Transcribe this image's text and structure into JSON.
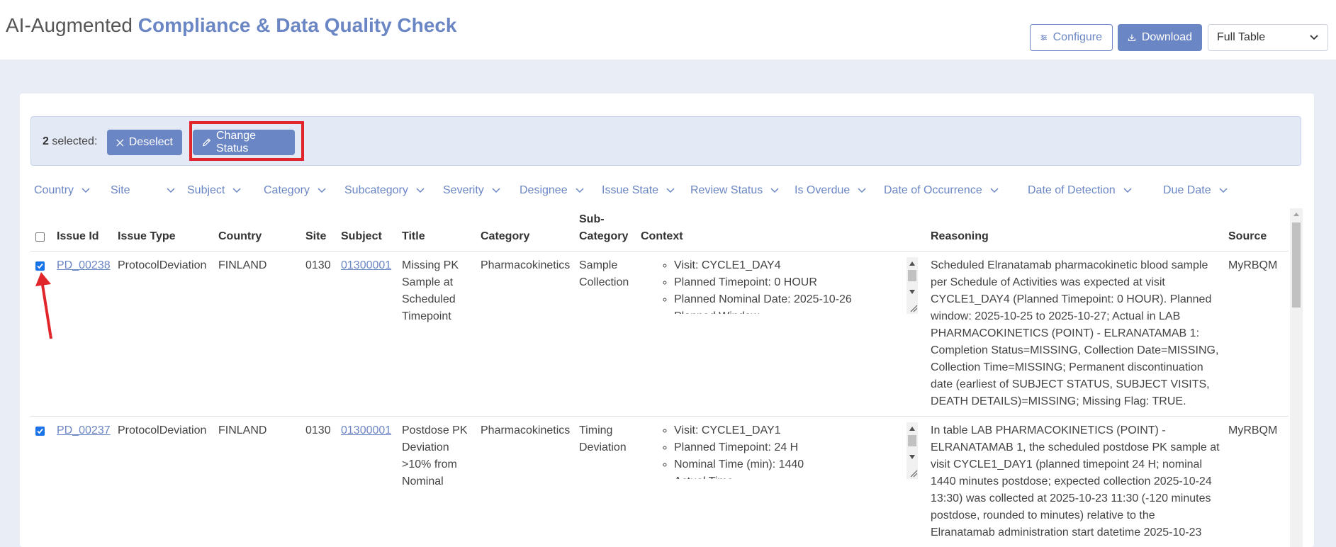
{
  "app": {
    "title_light": "AI-Augmented",
    "title_bold": "Compliance & Data Quality Check"
  },
  "toolbar": {
    "configure_label": "Configure",
    "download_label": "Download",
    "view_select_value": "Full Table"
  },
  "selection": {
    "count": "2",
    "count_suffix": "selected:",
    "deselect_label": "Deselect",
    "change_status_label": "Change Status"
  },
  "filters": [
    "Country",
    "Site",
    "Subject",
    "Category",
    "Subcategory",
    "Severity",
    "Designee",
    "Issue State",
    "Review Status",
    "Is Overdue",
    "Date of Occurrence",
    "Date of Detection",
    "Due Date"
  ],
  "table": {
    "headers": {
      "issue_id": "Issue Id",
      "issue_type": "Issue Type",
      "country": "Country",
      "site": "Site",
      "subject": "Subject",
      "title": "Title",
      "category": "Category",
      "subcategory_line1": "Sub-",
      "subcategory_line2": "Category",
      "context": "Context",
      "reasoning": "Reasoning",
      "source": "Source"
    },
    "rows": [
      {
        "issue_id": "PD_00238",
        "issue_type": "ProtocolDeviation",
        "country": "FINLAND",
        "site": "0130",
        "subject": "01300001",
        "title": "Missing PK Sample at Scheduled Timepoint",
        "category": "Pharmacokinetics",
        "subcategory": "Sample Collection",
        "context": [
          "Visit: CYCLE1_DAY4",
          "Planned Timepoint: 0 HOUR",
          "Planned Nominal Date: 2025-10-26",
          "Planned Window"
        ],
        "reasoning": "Scheduled Elranatamab pharmacokinetic blood sample per Schedule of Activities was expected at visit CYCLE1_DAY4 (Planned Timepoint: 0 HOUR). Planned window: 2025-10-25 to 2025-10-27; Actual in LAB PHARMACOKINETICS (POINT) - ELRANATAMAB 1: Completion Status=MISSING, Collection Date=MISSING, Collection Time=MISSING; Permanent discontinuation date (earliest of SUBJECT STATUS, SUBJECT VISITS, DEATH DETAILS)=MISSING; Missing Flag: TRUE.",
        "source": "MyRBQM",
        "selected": true
      },
      {
        "issue_id": "PD_00237",
        "issue_type": "ProtocolDeviation",
        "country": "FINLAND",
        "site": "0130",
        "subject": "01300001",
        "title": "Postdose PK Deviation >10% from Nominal",
        "category": "Pharmacokinetics",
        "subcategory": "Timing Deviation",
        "context": [
          "Visit: CYCLE1_DAY1",
          "Planned Timepoint: 24 H",
          "Nominal Time (min): 1440",
          "Actual Time"
        ],
        "reasoning": "In table LAB PHARMACOKINETICS (POINT) - ELRANATAMAB 1, the scheduled postdose PK sample at visit CYCLE1_DAY1 (planned timepoint 24 H; nominal 1440 minutes postdose; expected collection 2025-10-24 13:30) was collected at 2025-10-23 11:30 (-120 minutes postdose, rounded to minutes) relative to the Elranatamab administration start datetime 2025-10-23",
        "source": "MyRBQM",
        "selected": true
      }
    ]
  },
  "colors": {
    "accent": "#6b86c4",
    "page_bg": "#e9edf6",
    "highlight": "#e0262b"
  }
}
